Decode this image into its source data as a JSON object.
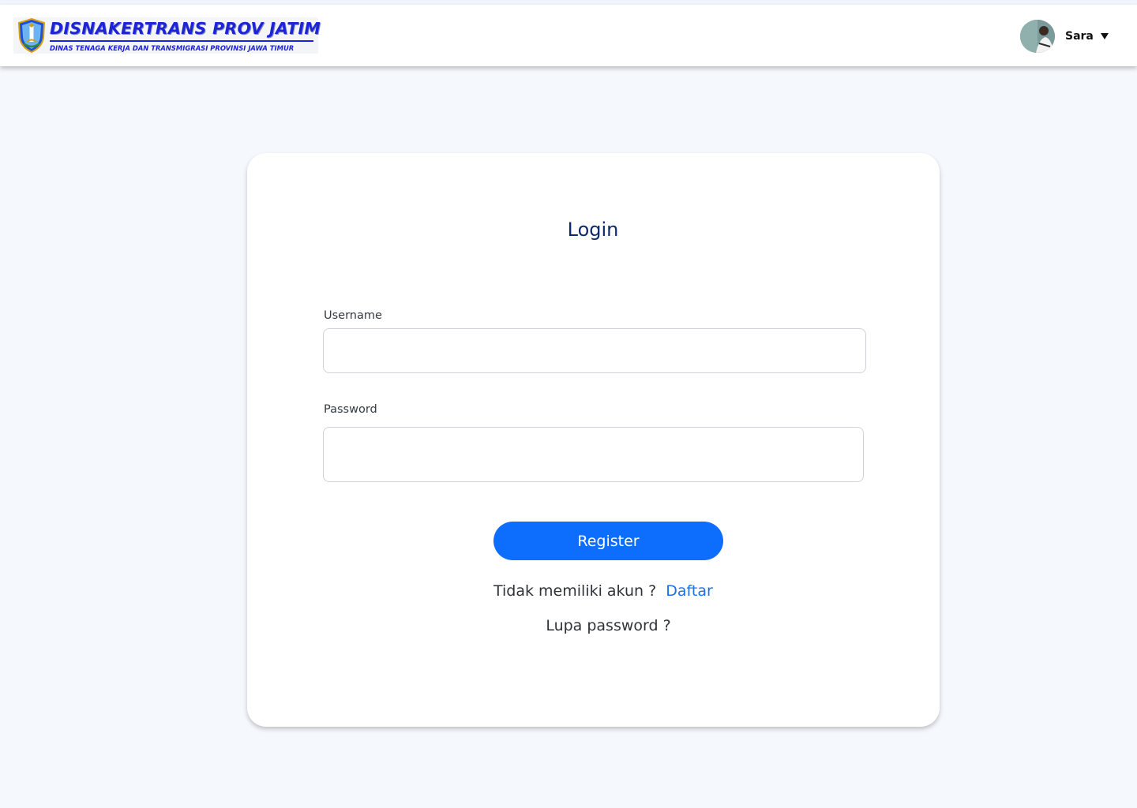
{
  "header": {
    "logo_title": "DISNAKERTRANS PROV JATIM",
    "logo_subtitle": "DINAS TENAGA KERJA DAN TRANSMIGRASI PROVINSI JAWA TIMUR",
    "user_name": "Sara"
  },
  "login": {
    "title": "Login",
    "username_label": "Username",
    "username_value": "",
    "password_label": "Password",
    "password_value": "",
    "submit_label": "Register",
    "no_account_text": "Tidak memiliki akun ?",
    "signup_link": "Daftar",
    "forgot_password": "Lupa password ?"
  },
  "colors": {
    "primary": "#0d6efd",
    "link": "#1a73e8",
    "title": "#0c2a6b",
    "logo_blue": "#1d23d6",
    "background": "#f5f8fd"
  },
  "icons": [
    "jatim-emblem-icon",
    "chevron-down-icon"
  ]
}
